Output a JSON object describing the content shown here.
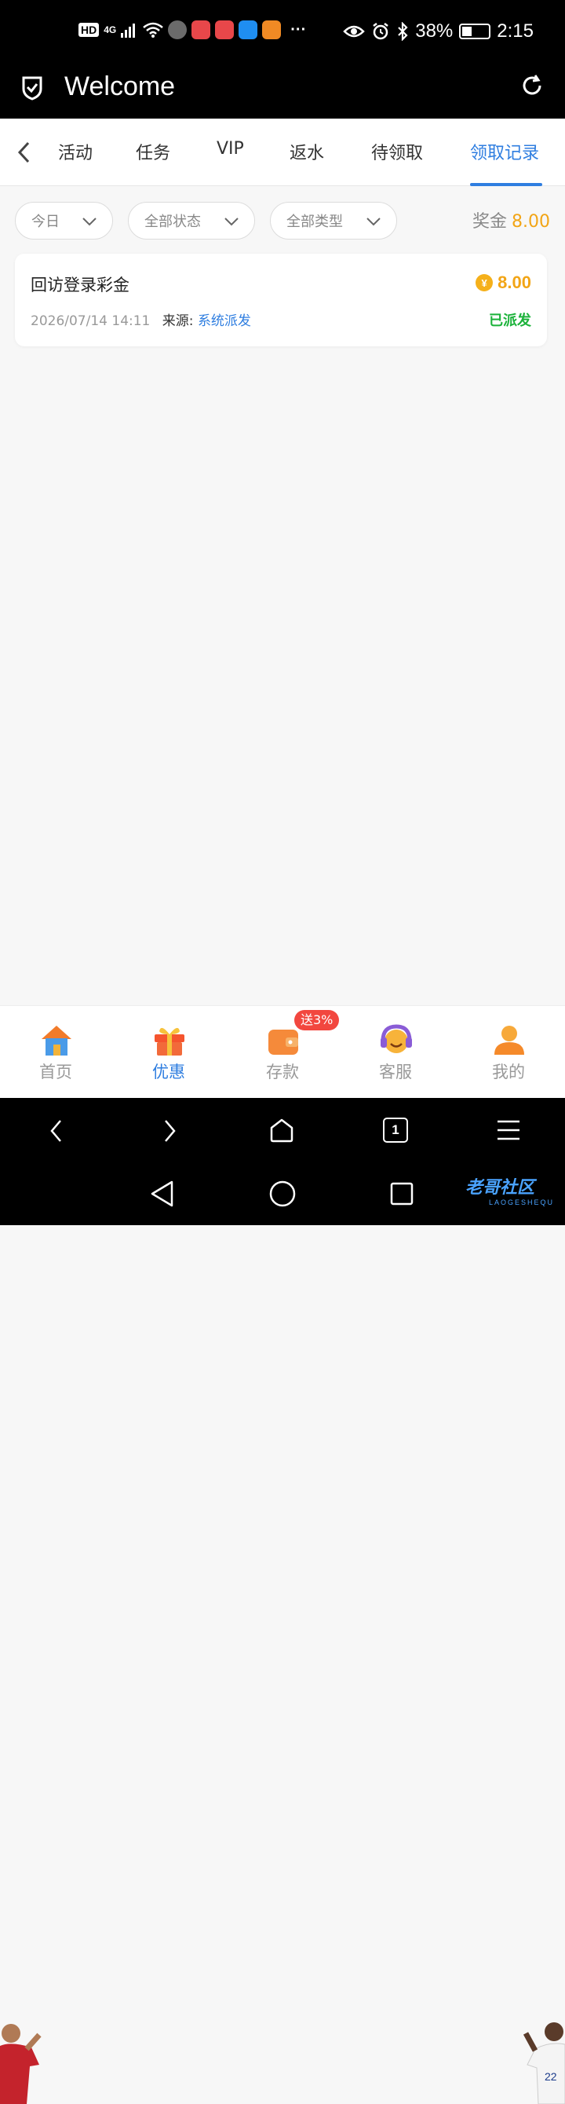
{
  "status_bar": {
    "hd": "HD",
    "signal": "4G",
    "battery": "38%",
    "battery_level": 0.38,
    "time": "2:15",
    "more": "···"
  },
  "header": {
    "title": "Welcome"
  },
  "tabs": [
    {
      "label": "活动",
      "active": false
    },
    {
      "label": "任务",
      "active": false
    },
    {
      "label": "VIP",
      "active": false
    },
    {
      "label": "返水",
      "active": false
    },
    {
      "label": "待领取",
      "active": false
    },
    {
      "label": "领取记录",
      "active": true
    }
  ],
  "filters": {
    "date": "今日",
    "status": "全部状态",
    "type": "全部类型"
  },
  "bonus": {
    "label": "奖金",
    "value": "8.00"
  },
  "records": [
    {
      "title": "回访登录彩金",
      "amount": "8.00",
      "currency_symbol": "¥",
      "datetime": "2026/07/14 14:11",
      "source_label": "来源:",
      "source": "系统派发",
      "status": "已派发"
    }
  ],
  "bottom_nav": [
    {
      "label": "首页",
      "icon": "house-icon",
      "active": false
    },
    {
      "label": "优惠",
      "icon": "gift-icon",
      "active": true
    },
    {
      "label": "存款",
      "icon": "wallet-icon",
      "active": false
    },
    {
      "label": "客服",
      "icon": "headset-icon",
      "active": false
    },
    {
      "label": "我的",
      "icon": "user-icon",
      "active": false
    }
  ],
  "deposit_badge": "送3%",
  "browser_bar": {
    "tab_count": "1"
  },
  "watermark": {
    "text": "老哥社区",
    "sub": "LAOGESHEQU"
  },
  "colors": {
    "accent": "#2f7ee0",
    "gold": "#f2a516",
    "success": "#1bb23a",
    "badge": "#f2473f"
  }
}
